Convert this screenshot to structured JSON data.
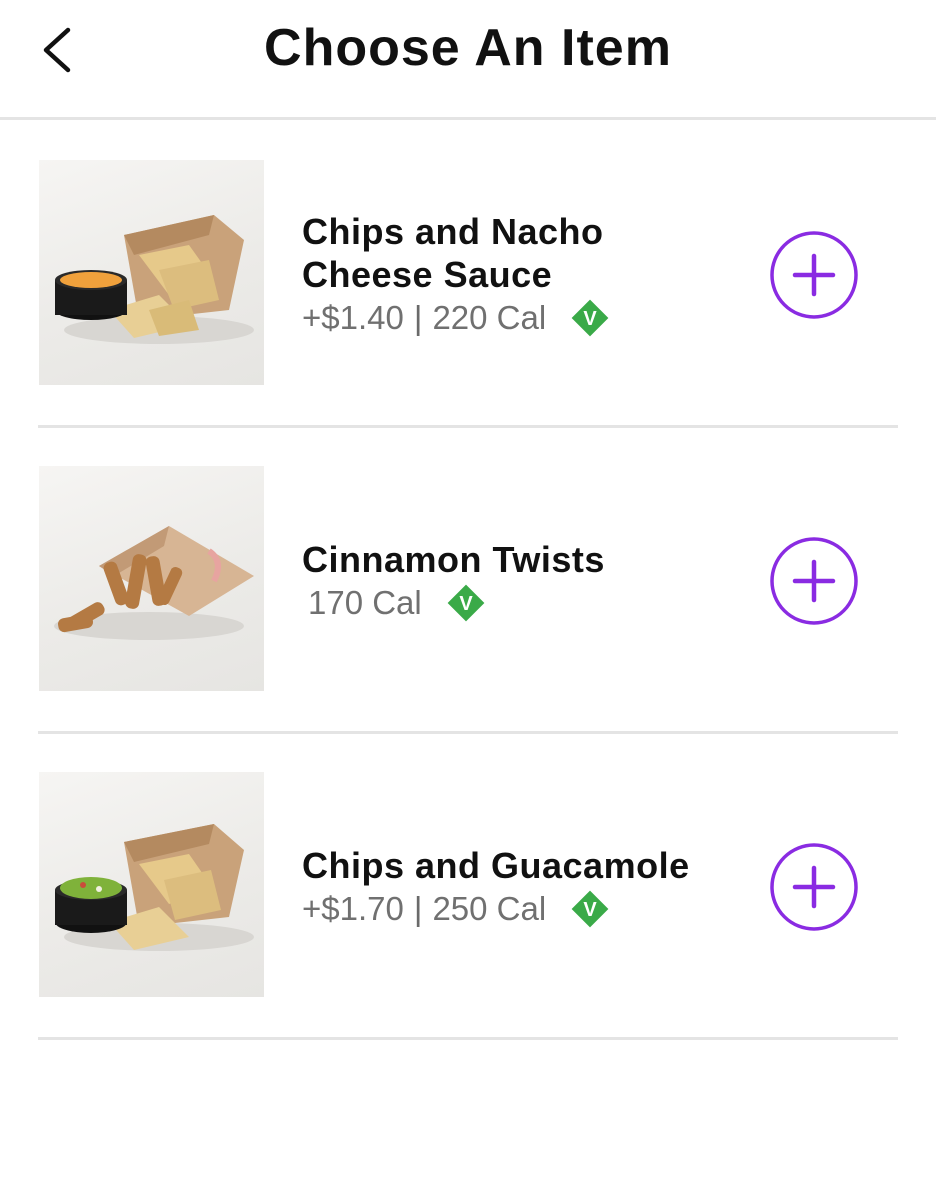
{
  "header": {
    "title": "Choose An Item",
    "back_icon": "chevron-left-icon"
  },
  "colors": {
    "accent": "#8a2be2",
    "veg_badge": "#3aaa48",
    "divider": "#e4e4e4",
    "meta_text": "#707070"
  },
  "items": [
    {
      "name_line1": "Chips and Nacho",
      "name_line2": "Cheese Sauce",
      "price": "+$1.40",
      "separator": "|",
      "calories": "220 Cal",
      "badge": "V",
      "image": "chips-and-nacho-cheese-image",
      "add_icon": "plus-circle-icon"
    },
    {
      "name_line1": "Cinnamon Twists",
      "calories": "170 Cal",
      "badge": "V",
      "image": "cinnamon-twists-image",
      "add_icon": "plus-circle-icon"
    },
    {
      "name_line1": "Chips and Guacamole",
      "price": "+$1.70",
      "separator": "|",
      "calories": "250 Cal",
      "badge": "V",
      "image": "chips-and-guacamole-image",
      "add_icon": "plus-circle-icon"
    }
  ]
}
